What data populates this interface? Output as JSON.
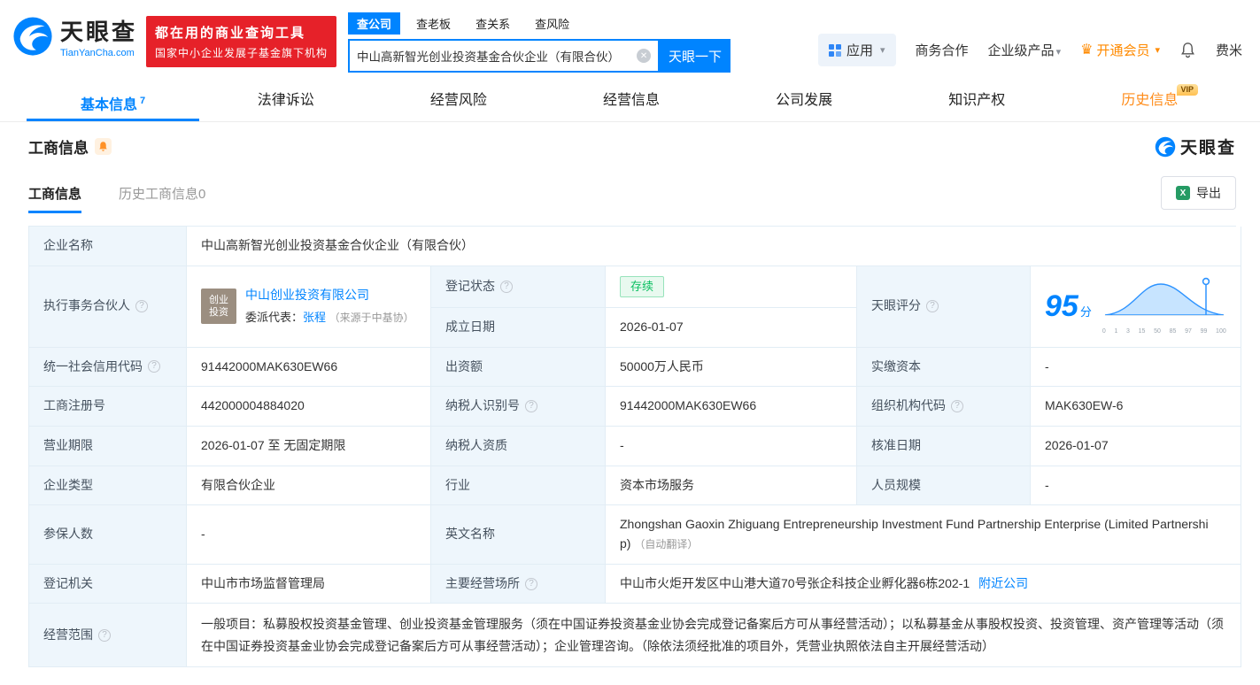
{
  "colors": {
    "primary": "#0084ff",
    "promo_red": "#e62129",
    "vip_orange": "#ff8a00",
    "status_green": "#0bc061"
  },
  "header": {
    "brand": "天眼查",
    "brand_domain": "TianYanCha.com",
    "promo_line1": "都在用的商业查询工具",
    "promo_line2": "国家中小企业发展子基金旗下机构",
    "search_tabs": [
      {
        "label": "查公司"
      },
      {
        "label": "查老板"
      },
      {
        "label": "查关系"
      },
      {
        "label": "查风险"
      }
    ],
    "search_value": "中山高新智光创业投资基金合伙企业（有限合伙）",
    "search_button": "天眼一下",
    "menu_app": "应用",
    "menu_cooperation": "商务合作",
    "menu_enterprise": "企业级产品",
    "menu_vip": "开通会员",
    "menu_user": "费米"
  },
  "nav": {
    "tabs": [
      {
        "label": "基本信息",
        "badge": "7"
      },
      {
        "label": "法律诉讼"
      },
      {
        "label": "经营风险"
      },
      {
        "label": "经营信息"
      },
      {
        "label": "公司发展"
      },
      {
        "label": "知识产权"
      },
      {
        "label": "历史信息",
        "vip": "VIP"
      }
    ]
  },
  "section": {
    "title": "工商信息",
    "watermark_brand": "天眼查",
    "tab_current": "工商信息",
    "tab_history": "历史工商信息0",
    "export_label": "导出"
  },
  "info": {
    "company_name_label": "企业名称",
    "company_name": "中山高新智光创业投资基金合伙企业（有限合伙）",
    "partner_label": "执行事务合伙人",
    "partner_logo_line1": "创业",
    "partner_logo_line2": "投资",
    "partner_company": "中山创业投资有限公司",
    "partner_rep_label": "委派代表：",
    "partner_rep_name": "张程",
    "partner_rep_source": "（来源于中基协）",
    "status_label": "登记状态",
    "status_value": "存续",
    "establish_label": "成立日期",
    "establish_value": "2026-01-07",
    "score_label": "天眼评分",
    "score_value": "95",
    "score_unit": "分",
    "score_axis": [
      "0",
      "1",
      "3",
      "15",
      "50",
      "85",
      "97",
      "99",
      "100"
    ],
    "credit_code_label": "统一社会信用代码",
    "credit_code": "91442000MAK630EW66",
    "capital_label": "出资额",
    "capital": "50000万人民币",
    "paid_label": "实缴资本",
    "paid": "-",
    "regno_label": "工商注册号",
    "regno": "442000004884020",
    "tax_id_label": "纳税人识别号",
    "tax_id": "91442000MAK630EW66",
    "org_code_label": "组织机构代码",
    "org_code": "MAK630EW-6",
    "term_label": "营业期限",
    "term": "2026-01-07 至 无固定期限",
    "tax_quality_label": "纳税人资质",
    "tax_quality": "-",
    "approval_label": "核准日期",
    "approval": "2026-01-07",
    "type_label": "企业类型",
    "type": "有限合伙企业",
    "industry_label": "行业",
    "industry": "资本市场服务",
    "staff_label": "人员规模",
    "staff": "-",
    "insured_label": "参保人数",
    "insured": "-",
    "en_name_label": "英文名称",
    "en_name": "Zhongshan Gaoxin Zhiguang Entrepreneurship Investment Fund Partnership Enterprise (Limited Partnership)",
    "en_name_note": "（自动翻译）",
    "authority_label": "登记机关",
    "authority": "中山市市场监督管理局",
    "address_label": "主要经营场所",
    "address": "中山市火炬开发区中山港大道70号张企科技企业孵化器6栋202-1",
    "address_link": "附近公司",
    "scope_label": "经营范围",
    "scope": "一般项目：私募股权投资基金管理、创业投资基金管理服务（须在中国证券投资基金业协会完成登记备案后方可从事经营活动）；以私募基金从事股权投资、投资管理、资产管理等活动（须在中国证券投资基金业协会完成登记备案后方可从事经营活动）；企业管理咨询。（除依法须经批准的项目外，凭营业执照依法自主开展经营活动）"
  }
}
